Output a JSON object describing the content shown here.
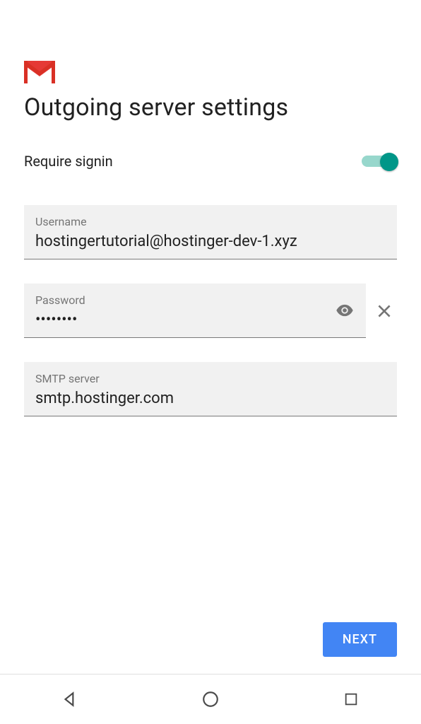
{
  "header": {
    "title": "Outgoing server settings"
  },
  "toggle": {
    "label": "Require signin",
    "on": true
  },
  "fields": {
    "username": {
      "label": "Username",
      "value": "hostingertutorial@hostinger-dev-1.xyz"
    },
    "password": {
      "label": "Password",
      "value": "••••••••"
    },
    "smtp": {
      "label": "SMTP server",
      "value": "smtp.hostinger.com"
    }
  },
  "actions": {
    "next": "NEXT"
  }
}
